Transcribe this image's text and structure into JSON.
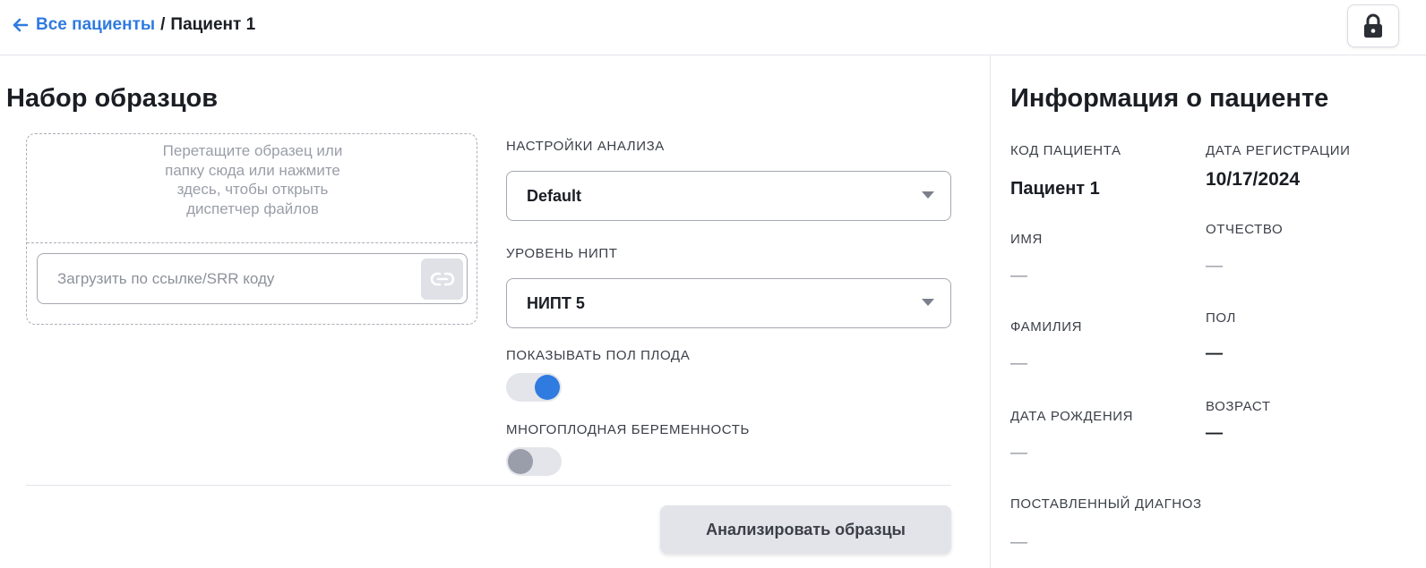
{
  "breadcrumb": {
    "back_label": "Все пациенты",
    "separator": "/",
    "current": "Пациент 1"
  },
  "sample_set": {
    "title": "Набор образцов",
    "drop_text": "Перетащите образец или папку сюда или нажмите здесь, чтобы открыть диспетчер файлов",
    "url_placeholder": "Загрузить по ссылке/SRR коду",
    "url_value": ""
  },
  "settings": {
    "analysis_label": "НАСТРОЙКИ АНАЛИЗА",
    "analysis_value": "Default",
    "nipt_label": "УРОВЕНЬ НИПТ",
    "nipt_value": "НИПТ 5",
    "fetal_sex_label": "ПОКАЗЫВАТЬ ПОЛ ПЛОДА",
    "fetal_sex_enabled": true,
    "multiple_pregnancy_label": "МНОГОПЛОДНАЯ БЕРЕМЕННОСТЬ",
    "multiple_pregnancy_enabled": false,
    "analyze_button": "Анализировать образцы"
  },
  "patient_info": {
    "title": "Информация о пациенте",
    "code_label": "КОД ПАЦИЕНТА",
    "code_value": "Пациент 1",
    "reg_date_label": "ДАТА РЕГИСТРАЦИИ",
    "reg_date_value": "10/17/2024",
    "first_name_label": "ИМЯ",
    "first_name_value": "—",
    "patronymic_label": "ОТЧЕСТВО",
    "patronymic_value": "—",
    "last_name_label": "ФАМИЛИЯ",
    "last_name_value": "—",
    "sex_label": "ПОЛ",
    "sex_value": "—",
    "birth_date_label": "ДАТА РОЖДЕНИЯ",
    "birth_date_value": "—",
    "age_label": "ВОЗРАСТ",
    "age_value": "—",
    "diagnosis_label": "ПОСТАВЛЕННЫЙ ДИАГНОЗ",
    "diagnosis_value": "—"
  },
  "colors": {
    "accent": "#2f7be0",
    "toggle_off_knob": "#9a9daa",
    "button_bg": "#e2e4e9"
  },
  "icons": {
    "back": "arrow-left-icon",
    "lock": "lock-icon",
    "link": "link-icon",
    "caret": "chevron-down-icon"
  }
}
